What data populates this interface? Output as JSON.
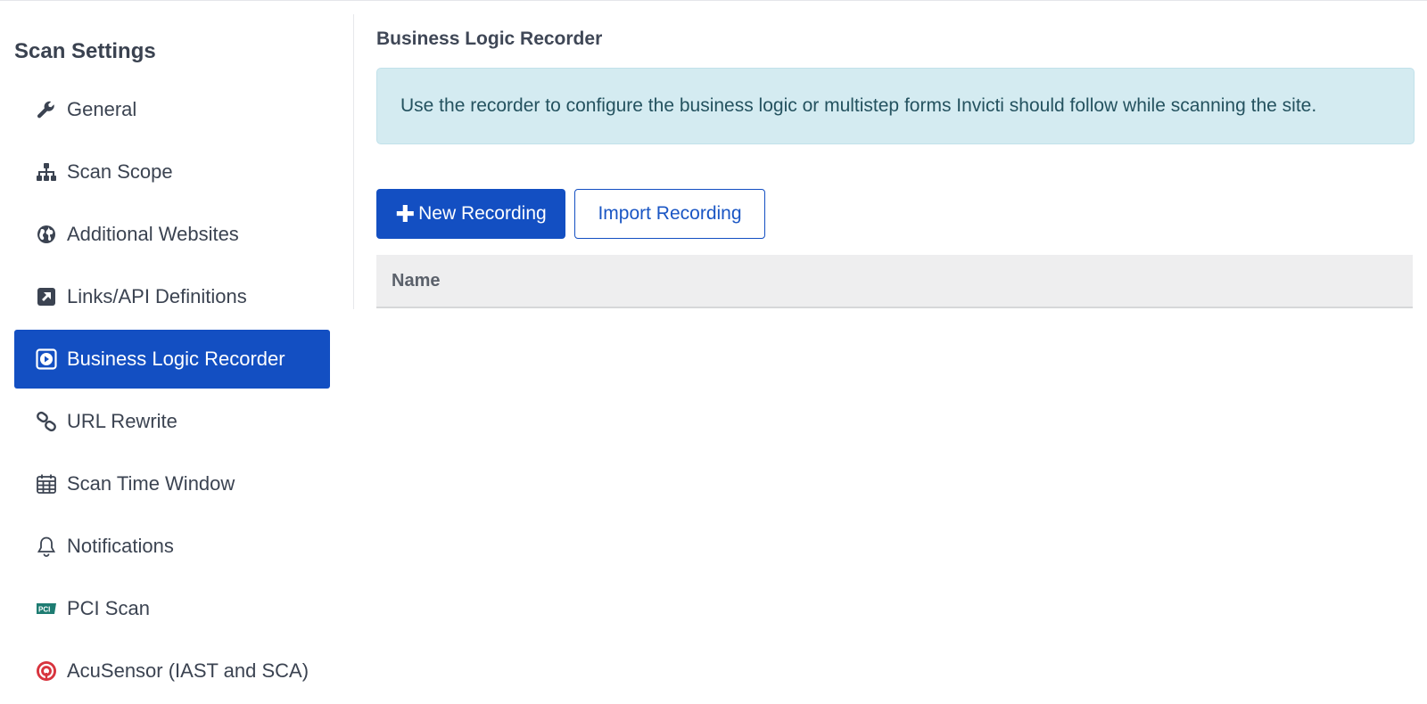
{
  "sidebar": {
    "title": "Scan Settings",
    "items": [
      {
        "label": "General",
        "icon": "wrench-icon"
      },
      {
        "label": "Scan Scope",
        "icon": "sitemap-icon"
      },
      {
        "label": "Additional Websites",
        "icon": "globe-icon"
      },
      {
        "label": "Links/API Definitions",
        "icon": "external-link-icon"
      },
      {
        "label": "Business Logic Recorder",
        "icon": "play-icon",
        "active": true
      },
      {
        "label": "URL Rewrite",
        "icon": "link-icon"
      },
      {
        "label": "Scan Time Window",
        "icon": "calendar-icon"
      },
      {
        "label": "Notifications",
        "icon": "bell-icon"
      },
      {
        "label": "PCI Scan",
        "icon": "pci-icon"
      },
      {
        "label": "AcuSensor (IAST and SCA)",
        "icon": "acusensor-icon"
      }
    ]
  },
  "main": {
    "title": "Business Logic Recorder",
    "info": "Use the recorder to configure the business logic or multistep forms Invicti should follow while scanning the site.",
    "new_recording": "New Recording",
    "import_recording": "Import Recording",
    "table": {
      "columns": [
        "Name"
      ],
      "rows": []
    }
  },
  "colors": {
    "accent": "#134fc2",
    "info_bg": "#d4ebf1",
    "info_text": "#24525f"
  }
}
